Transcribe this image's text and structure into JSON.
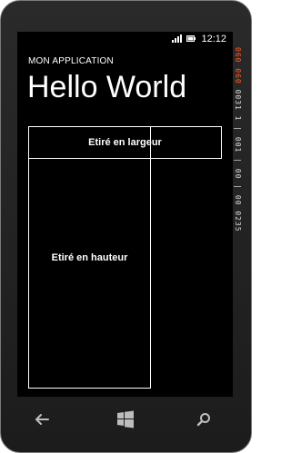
{
  "status_bar": {
    "time": "12:12",
    "icons": [
      "signal-icon",
      "battery-icon"
    ]
  },
  "app": {
    "title": "MON APPLICATION",
    "page_title": "Hello World"
  },
  "content": {
    "stretch_width_label": "Etiré en largeur",
    "stretch_height_label": "Etiré en hauteur"
  },
  "debug_counter": {
    "highlight_a": "060",
    "highlight_b": "060",
    "rest": "0031 1 | 001 | 00 | 00 0235"
  },
  "nav": {
    "back_icon": "back-arrow-icon",
    "start_icon": "windows-start-icon",
    "search_icon": "search-icon"
  },
  "colors": {
    "background": "#000000",
    "foreground": "#ffffff",
    "counter_accent": "#ff5a1f"
  }
}
